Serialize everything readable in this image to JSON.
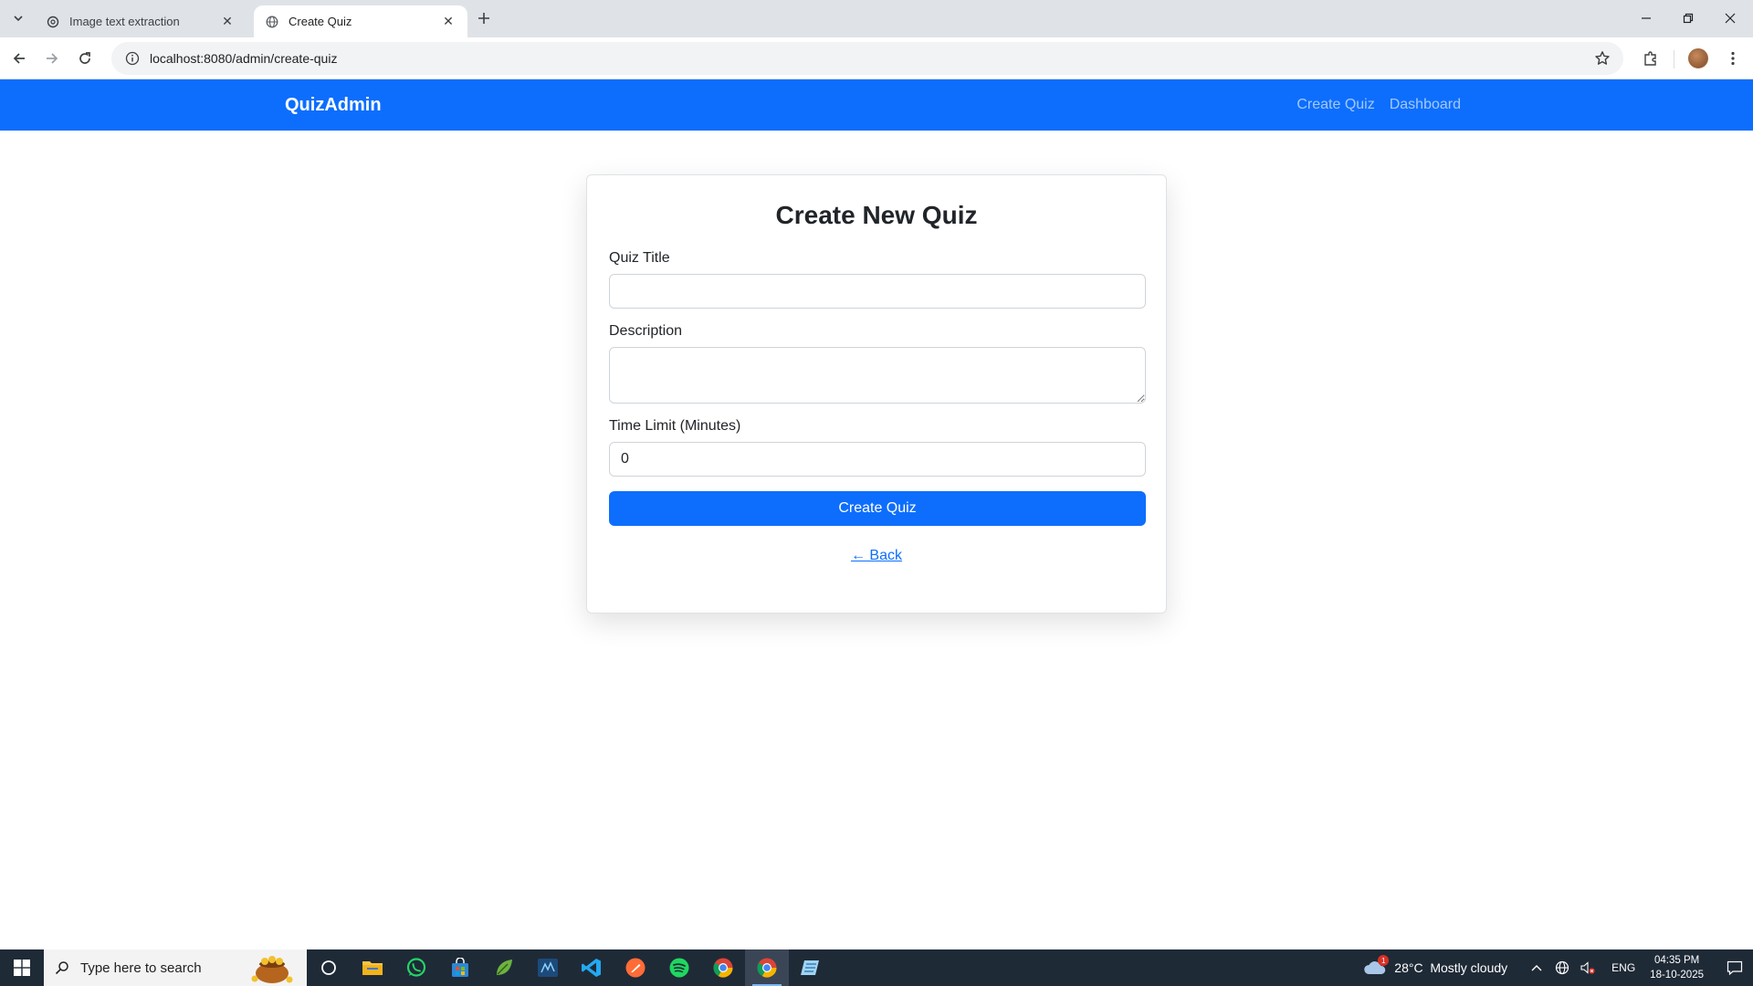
{
  "browser": {
    "tabs": [
      {
        "title": "Image text extraction",
        "active": false
      },
      {
        "title": "Create Quiz",
        "active": true
      }
    ],
    "url": "localhost:8080/admin/create-quiz"
  },
  "navbar": {
    "brand": "QuizAdmin",
    "links": [
      {
        "label": "Create Quiz"
      },
      {
        "label": "Dashboard"
      }
    ]
  },
  "form": {
    "heading": "Create New Quiz",
    "title_label": "Quiz Title",
    "title_value": "",
    "description_label": "Description",
    "description_value": "",
    "time_label": "Time Limit (Minutes)",
    "time_value": "0",
    "submit_label": "Create Quiz",
    "back_label": "← Back"
  },
  "taskbar": {
    "search_placeholder": "Type here to search",
    "weather": "28°C  Mostly cloudy",
    "weather_badge": "1",
    "language": "ENG",
    "time": "04:35 PM",
    "date": "18-10-2025"
  },
  "colors": {
    "primary": "#0d6efd",
    "taskbar": "#1f2a37"
  }
}
